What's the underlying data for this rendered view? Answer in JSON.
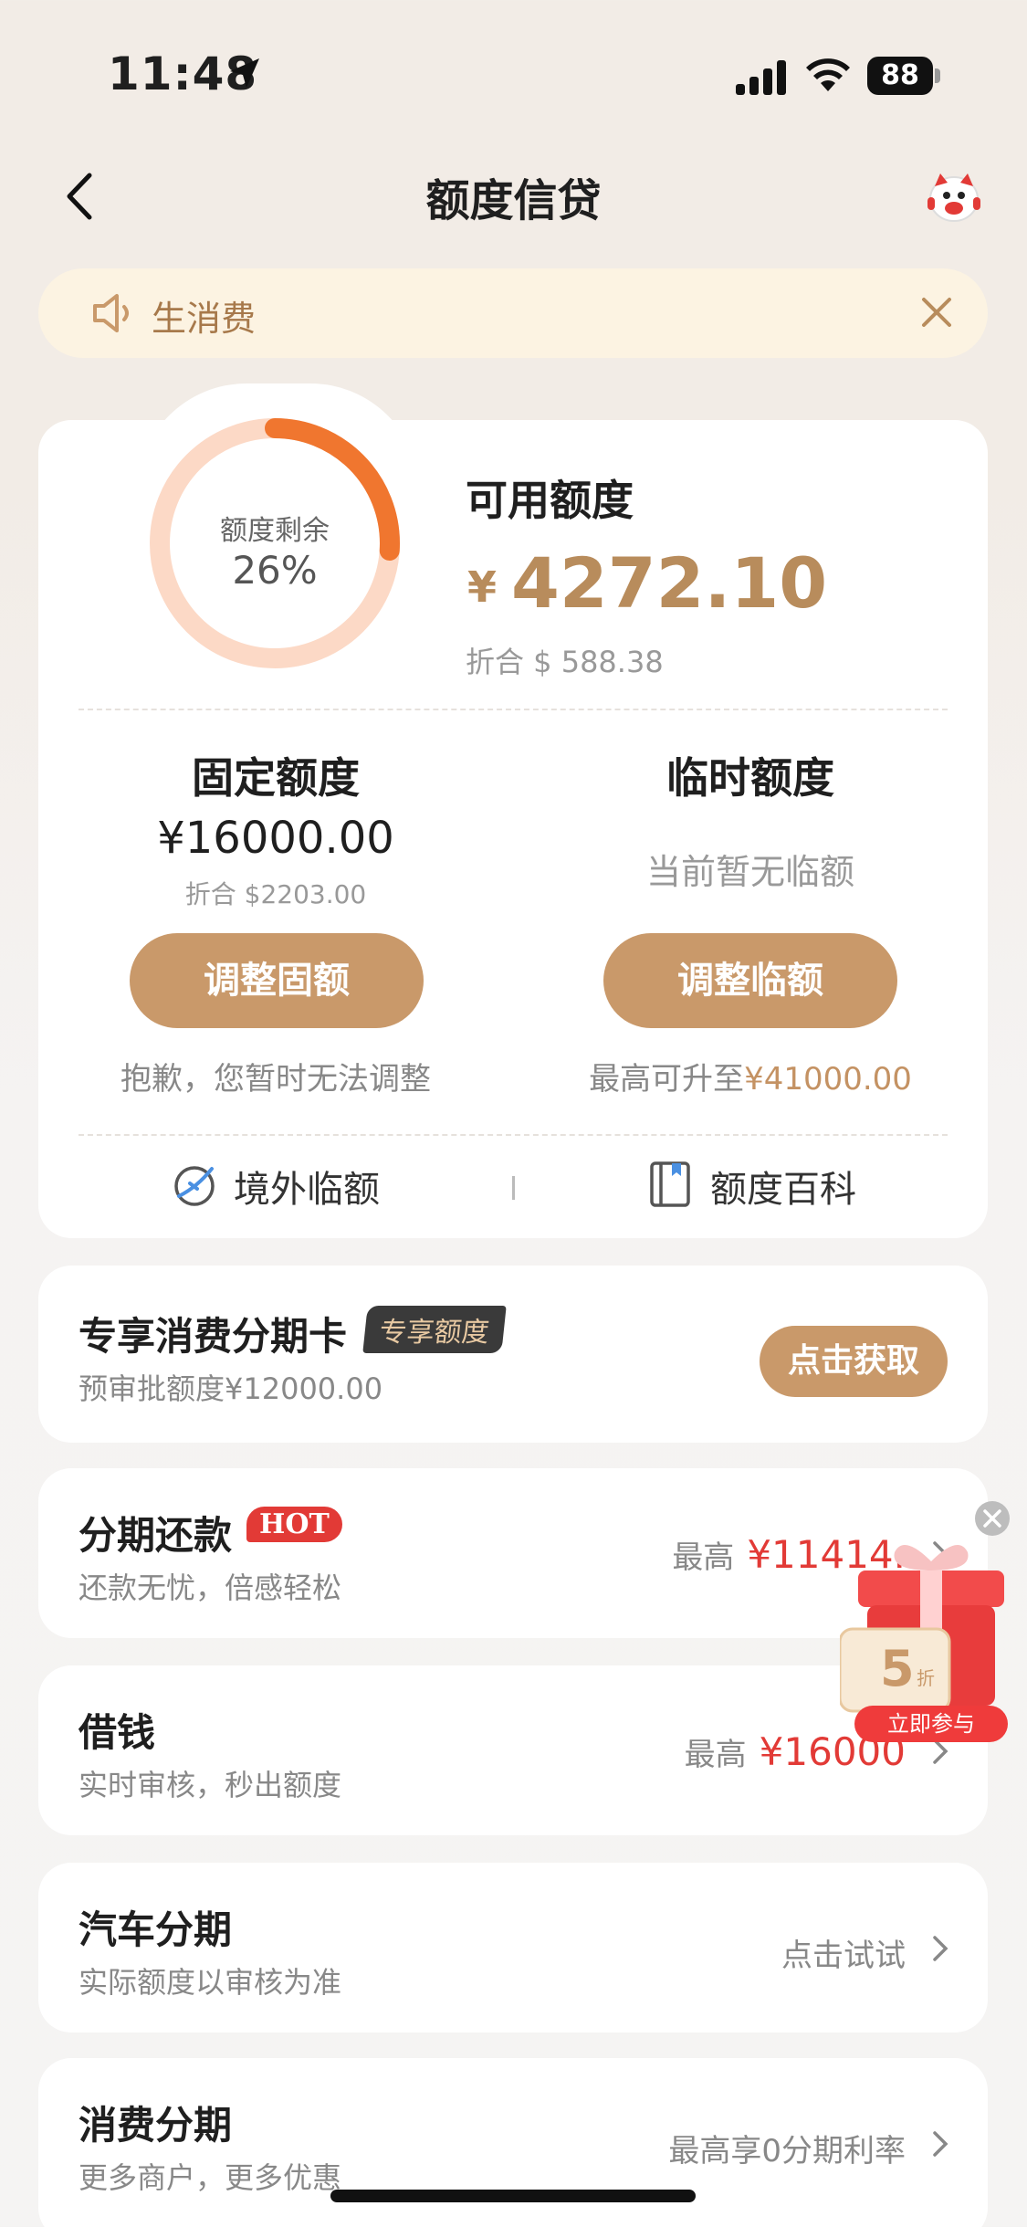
{
  "status_bar": {
    "time": "11:48",
    "battery": "88"
  },
  "nav": {
    "title": "额度信贷"
  },
  "notice": {
    "text": "生消费"
  },
  "credit": {
    "ring_label": "额度剩余",
    "ring_percent": "26%",
    "ring_fraction": 0.26,
    "available_title": "可用额度",
    "currency_symbol": "¥",
    "available_amount": "4272.10",
    "available_usd": "折合 $ 588.38",
    "fixed_title": "固定额度",
    "fixed_amount": "¥16000.00",
    "fixed_usd": "折合 $2203.00",
    "fixed_button": "调整固额",
    "fixed_note": "抱歉，您暂时无法调整",
    "temp_title": "临时额度",
    "temp_none": "当前暂无临额",
    "temp_button": "调整临额",
    "temp_note_prefix": "最高可升至",
    "temp_note_amount": "¥41000.00",
    "link_overseas": "境外临额",
    "link_wiki": "额度百科"
  },
  "cards": {
    "installment_card": {
      "title": "专享消费分期卡",
      "tag": "专享额度",
      "sub": "预审批额度¥12000.00",
      "button": "点击获取"
    },
    "repayment": {
      "title": "分期还款",
      "tag": "HOT",
      "sub": "还款无忧，倍感轻松",
      "right_prefix": "最高",
      "right_amount": "¥11414."
    },
    "borrow": {
      "title": "借钱",
      "sub": "实时审核，秒出额度",
      "right_prefix": "最高",
      "right_amount": "¥16000"
    },
    "car": {
      "title": "汽车分期",
      "sub": "实际额度以审核为准",
      "right": "点击试试"
    },
    "consumer": {
      "title": "消费分期",
      "sub": "更多商户，更多优惠",
      "right": "最高享0分期利率"
    }
  },
  "gift": {
    "discount": "5",
    "discount_unit": "折",
    "cta": "立即参与"
  },
  "colors": {
    "accent": "#c9996a",
    "ring_bg": "#fcd9c6",
    "ring_fg": "#f0762f",
    "red": "#e23a36",
    "notice_bg": "#fcf3e2"
  }
}
